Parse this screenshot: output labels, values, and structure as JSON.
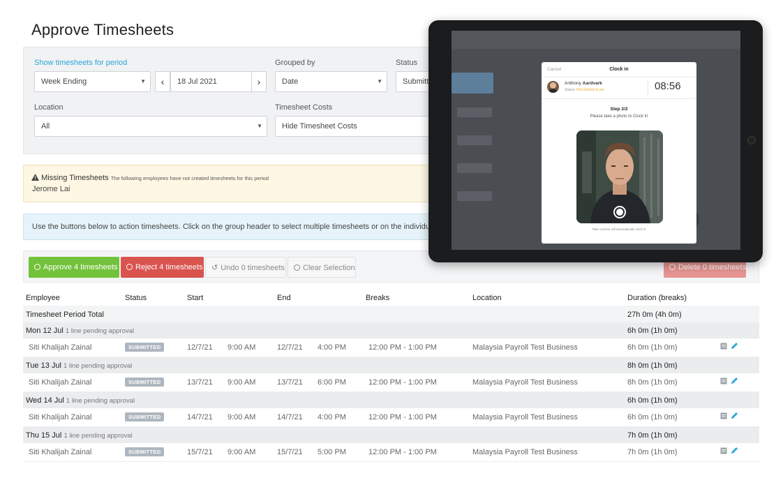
{
  "page": {
    "title": "Approve Timesheets"
  },
  "filters": {
    "period_label": "Show timesheets for period",
    "period_value": "Week Ending",
    "date_value": "18 Jul 2021",
    "grouped_label": "Grouped by",
    "grouped_value": "Date",
    "status_label": "Status",
    "status_value": "Submitted",
    "location_label": "Location",
    "location_value": "All",
    "costs_label": "Timesheet Costs",
    "costs_value": "Hide Timesheet Costs"
  },
  "missing": {
    "title": "Missing Timesheets",
    "desc": "The following employees have not created timesheets for this period",
    "employee": "Jerome Lai"
  },
  "info": {
    "text": "Use the buttons below to action timesheets. Click on the group header to select multiple timesheets or on the individual timesheet"
  },
  "actions": {
    "approve": "Approve 4 timesheets",
    "reject": "Reject 4 timesheets",
    "undo": "Undo 0 timesheets",
    "clear": "Clear Selection",
    "delete": "Delete 0 timesheets"
  },
  "table": {
    "headers": {
      "employee": "Employee",
      "status": "Status",
      "start": "Start",
      "end": "End",
      "breaks": "Breaks",
      "location": "Location",
      "duration": "Duration (breaks)"
    },
    "total": {
      "label": "Timesheet Period Total",
      "duration": "27h 0m (4h 0m)"
    },
    "groups": [
      {
        "date": "Mon 12 Jul",
        "pending": "1 line pending approval",
        "duration": "6h 0m (1h 0m)",
        "item": {
          "employee": "Siti Khalijah Zainal",
          "status": "SUBMITTED",
          "start_date": "12/7/21",
          "start_time": "9:00 AM",
          "end_date": "12/7/21",
          "end_time": "4:00 PM",
          "breaks": "12:00 PM - 1:00 PM",
          "location": "Malaysia Payroll Test Business",
          "duration": "6h 0m (1h 0m)"
        }
      },
      {
        "date": "Tue 13 Jul",
        "pending": "1 line pending approval",
        "duration": "8h 0m (1h 0m)",
        "item": {
          "employee": "Siti Khalijah Zainal",
          "status": "SUBMITTED",
          "start_date": "13/7/21",
          "start_time": "9:00 AM",
          "end_date": "13/7/21",
          "end_time": "6:00 PM",
          "breaks": "12:00 PM - 1:00 PM",
          "location": "Malaysia Payroll Test Business",
          "duration": "8h 0m (1h 0m)"
        }
      },
      {
        "date": "Wed 14 Jul",
        "pending": "1 line pending approval",
        "duration": "6h 0m (1h 0m)",
        "item": {
          "employee": "Siti Khalijah Zainal",
          "status": "SUBMITTED",
          "start_date": "14/7/21",
          "start_time": "9:00 AM",
          "end_date": "14/7/21",
          "end_time": "4:00 PM",
          "breaks": "12:00 PM - 1:00 PM",
          "location": "Malaysia Payroll Test Business",
          "duration": "6h 0m (1h 0m)"
        }
      },
      {
        "date": "Thu 15 Jul",
        "pending": "1 line pending approval",
        "duration": "7h 0m (1h 0m)",
        "item": {
          "employee": "Siti Khalijah Zainal",
          "status": "SUBMITTED",
          "start_date": "15/7/21",
          "start_time": "9:00 AM",
          "end_date": "15/7/21",
          "end_time": "5:00 PM",
          "breaks": "12:00 PM - 1:00 PM",
          "location": "Malaysia Payroll Test Business",
          "duration": "7h 0m (1h 0m)"
        }
      }
    ]
  },
  "tablet": {
    "cancel": "Cancel",
    "title": "Clock in",
    "first_name": "Anthony",
    "last_name": "Aardvark",
    "status_label": "Status:",
    "status_value": "Not clocked in yet",
    "time": "08:56",
    "step": "Step 2/2",
    "instruction": "Please take a photo to Clock In",
    "footnote": "Take a photo will automatically clock in"
  },
  "colors": {
    "approve": "#72c23b",
    "reject": "#d9534f",
    "delete": "#e79592",
    "accent": "#2aa5d6",
    "status_orange": "#f5a623",
    "badge": "#aeb6bf"
  },
  "icons": {
    "warning": "warning-icon",
    "approve": "check-circle-icon",
    "reject": "ban-icon",
    "undo": "undo-icon",
    "clear": "ban-icon",
    "delete": "times-circle-icon",
    "note": "note-icon",
    "edit": "pencil-icon",
    "shutter": "shutter-icon"
  }
}
